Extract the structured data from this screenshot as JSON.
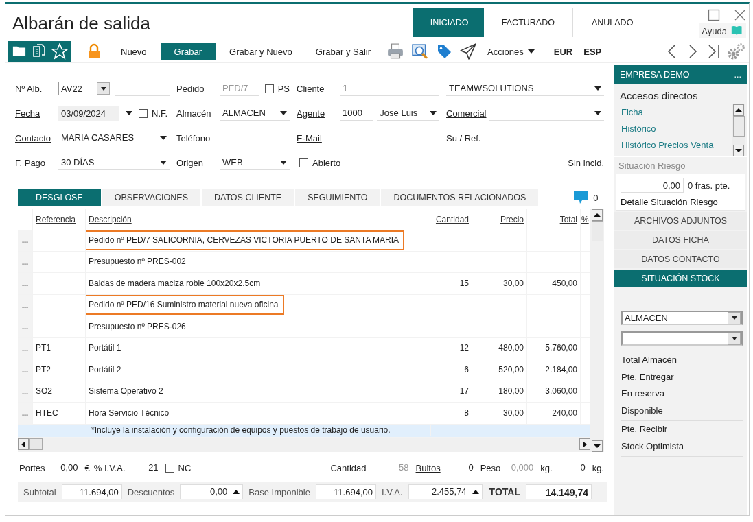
{
  "window": {
    "title": "Albarán de salida",
    "help": "Ayuda"
  },
  "status_tabs": [
    {
      "label": "INICIADO",
      "selected": true
    },
    {
      "label": "FACTURADO",
      "selected": false
    },
    {
      "label": "ANULADO",
      "selected": false
    }
  ],
  "toolbar": {
    "buttons": [
      {
        "label": "Nuevo",
        "primary": false
      },
      {
        "label": "Grabar",
        "primary": true
      },
      {
        "label": "Grabar y Nuevo",
        "primary": false
      },
      {
        "label": "Grabar y Salir",
        "primary": false
      }
    ],
    "actions": "Acciones",
    "links": [
      "EUR",
      "ESP"
    ]
  },
  "form": {
    "rows": [
      {
        "groups": [
          {
            "items": [
              {
                "kind": "link",
                "text": "Nº Alb."
              },
              {
                "kind": "combo",
                "value": "AV22"
              },
              {
                "kind": "field"
              }
            ]
          },
          {
            "items": [
              {
                "kind": "label",
                "text": "Pedido"
              },
              {
                "kind": "field",
                "value": "PED/7",
                "disabled": true
              },
              {
                "kind": "checkbox",
                "label": "PS",
                "checked": false
              }
            ]
          },
          {
            "items": [
              {
                "kind": "link",
                "text": "Cliente"
              },
              {
                "kind": "field",
                "value": "1",
                "disabled": false
              }
            ]
          },
          {
            "items": [
              {
                "kind": "select",
                "value": "TEAMWSOLUTIONS"
              }
            ]
          }
        ]
      },
      {
        "groups": [
          {
            "items": [
              {
                "kind": "link",
                "text": "Fecha"
              },
              {
                "kind": "date",
                "value": "03/09/2024"
              },
              {
                "kind": "checkbox",
                "label": "N.F.",
                "checked": false
              }
            ]
          },
          {
            "items": [
              {
                "kind": "label",
                "text": "Almacén"
              },
              {
                "kind": "select",
                "value": "ALMACEN"
              }
            ]
          },
          {
            "items": [
              {
                "kind": "link",
                "text": "Agente"
              },
              {
                "kind": "field",
                "value": "1000",
                "disabled": false
              },
              {
                "kind": "select",
                "value": "Jose Luis"
              }
            ]
          },
          {
            "items": [
              {
                "kind": "link",
                "text": "Comercial"
              },
              {
                "kind": "select"
              }
            ]
          }
        ]
      },
      {
        "groups": [
          {
            "items": [
              {
                "kind": "link",
                "text": "Contacto"
              },
              {
                "kind": "select",
                "value": "MARIA CASARES"
              }
            ]
          },
          {
            "items": [
              {
                "kind": "label",
                "text": "Teléfono"
              },
              {
                "kind": "field"
              }
            ]
          },
          {
            "items": [
              {
                "kind": "link",
                "text": "E-Mail"
              },
              {
                "kind": "field"
              }
            ]
          },
          {
            "items": [
              {
                "kind": "label",
                "text": "Su / Ref."
              },
              {
                "kind": "field"
              }
            ]
          }
        ]
      },
      {
        "groups": [
          {
            "items": [
              {
                "kind": "label",
                "text": "F. Pago"
              },
              {
                "kind": "select",
                "value": "30 DÍAS"
              }
            ]
          },
          {
            "items": [
              {
                "kind": "label",
                "text": "Origen"
              },
              {
                "kind": "select",
                "value": "WEB"
              }
            ]
          },
          {
            "items": [
              {
                "kind": "checkbox",
                "label": "Abierto",
                "checked": false
              }
            ]
          },
          {
            "items": [
              {
                "kind": "link",
                "text": "Sin incid."
              }
            ]
          }
        ]
      }
    ]
  },
  "detail_tabs": [
    {
      "label": "DESGLOSE",
      "selected": true
    },
    {
      "label": "OBSERVACIONES",
      "selected": false
    },
    {
      "label": "DATOS CLIENTE",
      "selected": false
    },
    {
      "label": "SEGUIMIENTO",
      "selected": false
    },
    {
      "label": "DOCUMENTOS RELACIONADOS",
      "selected": false
    }
  ],
  "comments": {
    "count": "0"
  },
  "table": {
    "columns": [
      "Referencia",
      "Descripción",
      "Cantidad",
      "Precio",
      "Total",
      "%"
    ],
    "rows": [
      {
        "handle": "...",
        "description": "Pedido nº PED/7 SALICORNIA, CERVEZAS VICTORIA PUERTO DE SANTA MARIA",
        "highlighted": true,
        "selected": false
      },
      {
        "handle": "...",
        "description": "Presupuesto nº PRES-002",
        "highlighted": false,
        "selected": false
      },
      {
        "handle": "...",
        "description": "Baldas de madera maciza roble 100x20x2.5cm",
        "quantity": "15",
        "price": "30,00",
        "total": "450,00",
        "highlighted": false,
        "selected": false
      },
      {
        "handle": "...",
        "description": "Pedido nº PED/16 Suministro material nueva oficina",
        "highlighted": true,
        "selected": false
      },
      {
        "handle": "...",
        "description": "Presupuesto nº PRES-026",
        "highlighted": false,
        "selected": false
      },
      {
        "handle": "...",
        "reference": "PT1",
        "description": "Portátil 1",
        "quantity": "12",
        "price": "480,00",
        "total": "5.760,00",
        "highlighted": false,
        "selected": false
      },
      {
        "handle": "...",
        "reference": "PT2",
        "description": "Portátil 2",
        "quantity": "6",
        "price": "520,00",
        "total": "2.184,00",
        "highlighted": false,
        "selected": false
      },
      {
        "handle": "...",
        "reference": "SO2",
        "description": "Sistema Operativo 2",
        "quantity": "17",
        "price": "180,00",
        "total": "3.060,00",
        "highlighted": false,
        "selected": false
      },
      {
        "handle": "...",
        "reference": "HTEC",
        "description": "Hora Servicio Técnico",
        "quantity": "8",
        "price": "30,00",
        "total": "240,00",
        "highlighted": false,
        "selected": false
      },
      {
        "description": "*Incluye la instalación y configuración de equipos y puestos de trabajo de usuario.",
        "highlighted": false,
        "selected": true
      }
    ]
  },
  "totals": {
    "left": [
      {
        "kind": "label",
        "text": "Portes"
      },
      {
        "kind": "field",
        "value": "0,00",
        "disabled": false
      },
      {
        "kind": "unit",
        "text": "€"
      },
      {
        "kind": "label",
        "text": "% I.V.A."
      },
      {
        "kind": "field",
        "value": "21",
        "disabled": false
      },
      {
        "kind": "checkbox",
        "label": "NC",
        "checked": false
      }
    ],
    "right": [
      {
        "kind": "label",
        "text": "Cantidad"
      },
      {
        "kind": "field",
        "value": "58",
        "disabled": true
      },
      {
        "kind": "link",
        "text": "Bultos"
      },
      {
        "kind": "field",
        "value": "0",
        "disabled": false
      },
      {
        "kind": "label",
        "text": "Peso"
      },
      {
        "kind": "field",
        "value": "0,000",
        "disabled": true
      },
      {
        "kind": "unit",
        "text": "kg."
      },
      {
        "kind": "field",
        "value": "0",
        "disabled": false
      },
      {
        "kind": "unit",
        "text": "kg."
      }
    ]
  },
  "summary": [
    {
      "kind": "label",
      "text": "Subtotal"
    },
    {
      "kind": "field",
      "value": "11.694,00"
    },
    {
      "kind": "label",
      "text": "Descuentos"
    },
    {
      "kind": "stepper",
      "value": "0,00"
    },
    {
      "kind": "label",
      "text": "Base Imponible"
    },
    {
      "kind": "field",
      "value": "11.694,00"
    },
    {
      "kind": "label",
      "text": "I.V.A."
    },
    {
      "kind": "stepper",
      "value": "2.455,74"
    },
    {
      "kind": "total_label",
      "text": "TOTAL"
    },
    {
      "kind": "total",
      "value": "14.149,74"
    }
  ],
  "sidebar": {
    "header": {
      "title": "EMPRESA DEMO",
      "menu": "..."
    },
    "shortcuts_title": "Accesos directos",
    "shortcuts": [
      "Ficha",
      "Histórico",
      "Histórico Precios Venta"
    ],
    "risk": {
      "caption": "Situación Riesgo",
      "amount": "0,00",
      "pending": "0 fras. pte.",
      "link": "Detalle Situación Riesgo"
    },
    "sections": [
      {
        "label": "ARCHIVOS ADJUNTOS",
        "selected": false
      },
      {
        "label": "DATOS FICHA",
        "selected": false
      },
      {
        "label": "DATOS CONTACTO",
        "selected": false
      },
      {
        "label": "SITUACIÓN STOCK",
        "selected": true
      }
    ],
    "stock": {
      "warehouse": "ALMACEN",
      "groups": [
        [
          "Total Almacén",
          "Pte. Entregar",
          "En reserva",
          "Disponible"
        ],
        [
          "Pte. Recibir",
          "Stock Optimista"
        ]
      ]
    }
  }
}
